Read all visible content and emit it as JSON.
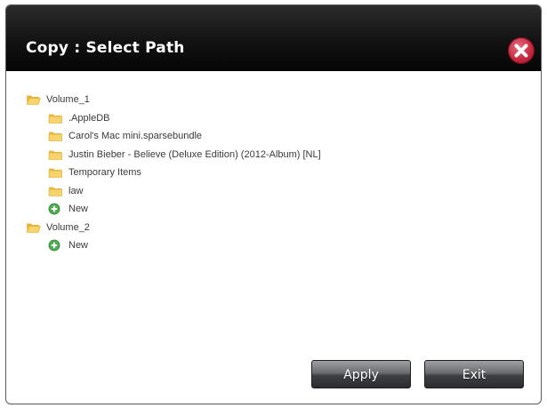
{
  "dialog": {
    "title": "Copy : Select Path",
    "close_icon": "close-x-icon"
  },
  "tree": [
    {
      "level": 1,
      "icon": "folder-open-icon",
      "label": "Volume_1"
    },
    {
      "level": 2,
      "icon": "folder-icon",
      "label": ".AppleDB"
    },
    {
      "level": 2,
      "icon": "folder-icon",
      "label": "Carol's Mac mini.sparsebundle"
    },
    {
      "level": 2,
      "icon": "folder-icon",
      "label": "Justin Bieber - Believe (Deluxe Edition) (2012-Album) [NL]"
    },
    {
      "level": 2,
      "icon": "folder-icon",
      "label": "Temporary Items"
    },
    {
      "level": 2,
      "icon": "folder-icon",
      "label": "law"
    },
    {
      "level": 2,
      "icon": "add-new-icon",
      "label": "New"
    },
    {
      "level": 1,
      "icon": "folder-open-icon",
      "label": "Volume_2"
    },
    {
      "level": 2,
      "icon": "add-new-icon",
      "label": "New"
    }
  ],
  "buttons": {
    "apply": "Apply",
    "exit": "Exit"
  },
  "colors": {
    "title_bar": "#121212",
    "close_button": "#c8283f",
    "folder": "#f2c94c",
    "new_icon": "#4caf50",
    "button": "#4a4c50"
  }
}
